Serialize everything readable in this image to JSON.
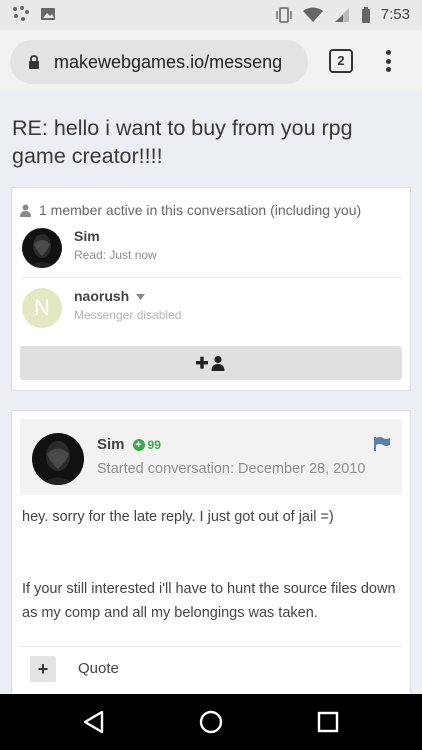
{
  "status": {
    "time": "7:53"
  },
  "browser": {
    "url": "makewebgames.io/messeng",
    "tab_count": "2"
  },
  "page": {
    "title": "RE: hello i want to buy from you rpg game creator!!!!"
  },
  "members": {
    "header": "1 member active in this conversation (including you)",
    "items": [
      {
        "name": "Sim",
        "status": "Read: Just now",
        "avatar": "dark-photo"
      },
      {
        "name": "naorush",
        "status": "Messenger disabled",
        "avatar_letter": "N",
        "avatar_color": "#e3e8c3"
      }
    ],
    "add_button_icon": "add-user-icon"
  },
  "post": {
    "author": "Sim",
    "reputation": "99",
    "started": "Started conversation: December 28, 2010",
    "paragraphs": [
      "hey. sorry for the late reply. I just got out of jail =)",
      "If your still interested i'll have to hunt the source files down as my comp and all my belongings was taken."
    ],
    "quote_plus": "+",
    "quote_label": "Quote"
  },
  "colors": {
    "reputation_green": "#3ea84a",
    "flag_blue": "#5b7fa8"
  }
}
